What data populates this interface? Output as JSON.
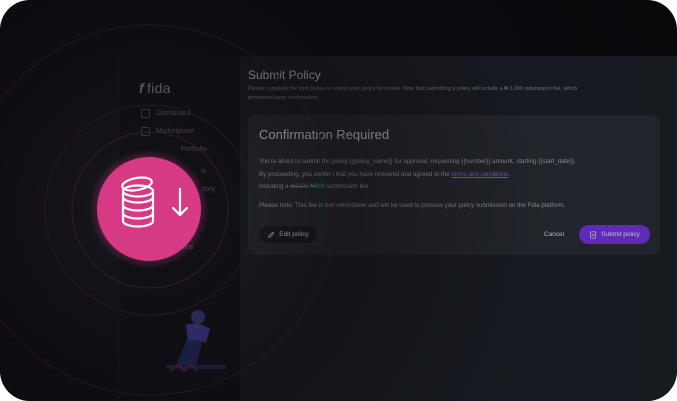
{
  "brand": {
    "name": "fida",
    "mark": "f"
  },
  "sidebar": {
    "items": [
      {
        "label": "Dashboard"
      },
      {
        "label": "Marketplace"
      },
      {
        "label": "Portfolio"
      },
      {
        "label": "lo"
      },
      {
        "label": "tory"
      },
      {
        "label": "one"
      }
    ]
  },
  "page": {
    "title": "Submit Policy",
    "description_line1": "Please complete the form below to submit your policy for review. Note that submitting a policy will include a ₦ 1,000 submission fee, which",
    "description_line2": "processed upon confirmation."
  },
  "dialog": {
    "title": "Confirmation Required",
    "line1": "You're about to submit the policy {{policy_name}} for approval, requesting {{number}} amount, starting {{start_date}}.",
    "line2_prefix": "By proceeding, you confirm that you have reviewed and agreed to the ",
    "terms_link": "terms and conditions",
    "line2_suffix": ".",
    "line3_prefix": "including a ",
    "old_fee": "₦1000",
    "new_fee": "₦900",
    "line3_suffix": " submission fee.",
    "note": "Please note: This fee is non-refundable and will be used to process your policy submission on the Fida platform.",
    "edit_button": "Edit policy",
    "cancel_button": "Cancel",
    "submit_button": "Submit policy"
  },
  "colors": {
    "accent": "#7b35f0",
    "badge": "#d63a84",
    "discount": "#35d08f",
    "link": "#8b7bf0"
  },
  "icons": {
    "edit": "pencil-icon",
    "submit": "document-icon",
    "badge": "coin-stack-icon",
    "badge_arrow": "arrow-down-icon"
  }
}
